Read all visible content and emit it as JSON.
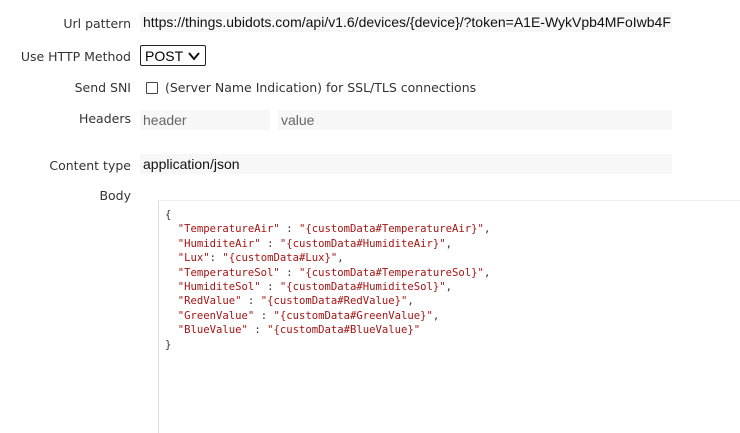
{
  "form": {
    "url_pattern": {
      "label": "Url pattern",
      "value": "https://things.ubidots.com/api/v1.6/devices/{device}/?token=A1E-WykVpb4MFoIwb4F"
    },
    "http_method": {
      "label": "Use HTTP Method",
      "selected": "POST",
      "icon": "chevron-down-icon"
    },
    "send_sni": {
      "label": "Send SNI",
      "checked": false,
      "description": "(Server Name Indication) for SSL/TLS connections"
    },
    "headers": {
      "label": "Headers",
      "name_placeholder": "header",
      "value_placeholder": "value"
    },
    "content_type": {
      "label": "Content type",
      "value": "application/json"
    },
    "body": {
      "label": "Body",
      "open_brace": "{",
      "close_brace": "}",
      "entries": [
        {
          "key": "\"TemperatureAir\"",
          "value": "\"{customData#TemperatureAir}\"",
          "sep": ",",
          "gap": " : "
        },
        {
          "key": "\"HumiditeAir\"",
          "value": "\"{customData#HumiditeAir}\"",
          "sep": ",",
          "gap": " : "
        },
        {
          "key": "\"Lux\"",
          "value": "\"{customData#Lux}\"",
          "sep": ",",
          "gap": ": "
        },
        {
          "key": "\"TemperatureSol\"",
          "value": "\"{customData#TemperatureSol}\"",
          "sep": ",",
          "gap": " : "
        },
        {
          "key": "\"HumiditeSol\"",
          "value": "\"{customData#HumiditeSol}\"",
          "sep": ",",
          "gap": " : "
        },
        {
          "key": "\"RedValue\"",
          "value": "\"{customData#RedValue}\"",
          "sep": ",",
          "gap": " : "
        },
        {
          "key": "\"GreenValue\"",
          "value": "\"{customData#GreenValue}\"",
          "sep": ",",
          "gap": " : "
        },
        {
          "key": "\"BlueValue\"",
          "value": "\"{customData#BlueValue}\"",
          "sep": "",
          "gap": " : "
        }
      ]
    }
  }
}
